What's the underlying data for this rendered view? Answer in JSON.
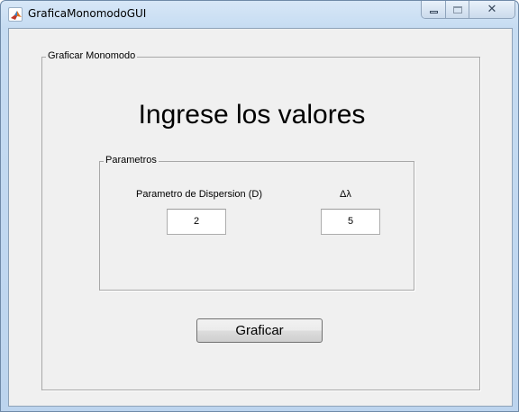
{
  "window": {
    "title": "GraficaMonomodoGUI",
    "app_icon": "matlab-icon",
    "controls": {
      "minimize": "minimize-icon",
      "maximize": "maximize-icon",
      "close_label": "✕"
    }
  },
  "main_panel": {
    "title": "Graficar Monomodo",
    "heading": "Ingrese los valores",
    "params_panel": {
      "title": "Parametros",
      "dispersion_label": "Parametro de Dispersion (D)",
      "dispersion_value": "2",
      "delta_lambda_label": "Δλ",
      "delta_lambda_value": "5"
    },
    "plot_button_label": "Graficar"
  }
}
